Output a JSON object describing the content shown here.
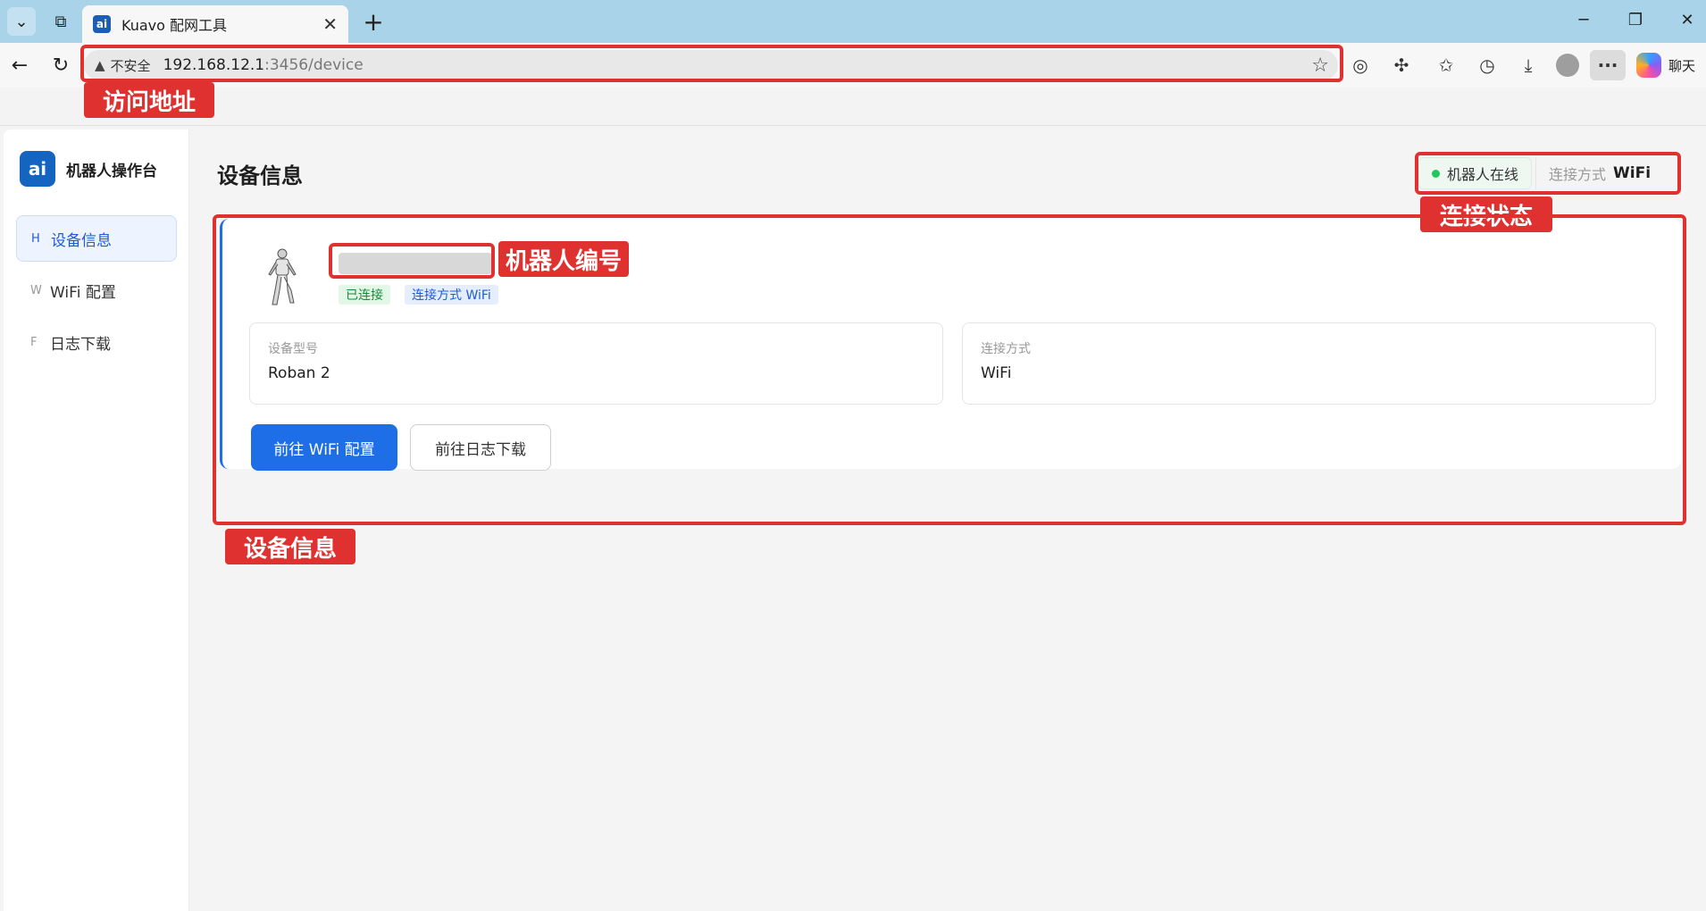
{
  "browser": {
    "tab_title": "Kuavo 配网工具",
    "tab_favicon_text": "ai",
    "address": {
      "insecure_label": "不安全",
      "url_host": "192.168.12.1",
      "url_rest": ":3456/device"
    },
    "copilot_label": "聊天"
  },
  "annotations": {
    "address": "访问地址",
    "status": "连接状态",
    "robot_id": "机器人编号",
    "device_info": "设备信息"
  },
  "app": {
    "brand": {
      "logo_text": "ai",
      "name": "机器人操作台"
    },
    "nav": [
      {
        "key": "H",
        "label": "设备信息",
        "active": true
      },
      {
        "key": "W",
        "label": "WiFi 配置",
        "active": false
      },
      {
        "key": "F",
        "label": "日志下载",
        "active": false
      }
    ],
    "page_title": "设备信息",
    "status": {
      "online_label": "机器人在线",
      "conn_label": "连接方式",
      "conn_value": "WiFi"
    },
    "device": {
      "badges": {
        "connected": "已连接",
        "wifi": "连接方式 WiFi"
      },
      "fields": [
        {
          "label": "设备型号",
          "value": "Roban 2"
        },
        {
          "label": "连接方式",
          "value": "WiFi"
        }
      ],
      "buttons": {
        "wifi_config": "前往 WiFi 配置",
        "log_download": "前往日志下载"
      }
    }
  },
  "colors": {
    "accent": "#1e6ee8",
    "annotation_red": "#e03131",
    "online_green": "#22c55e"
  }
}
